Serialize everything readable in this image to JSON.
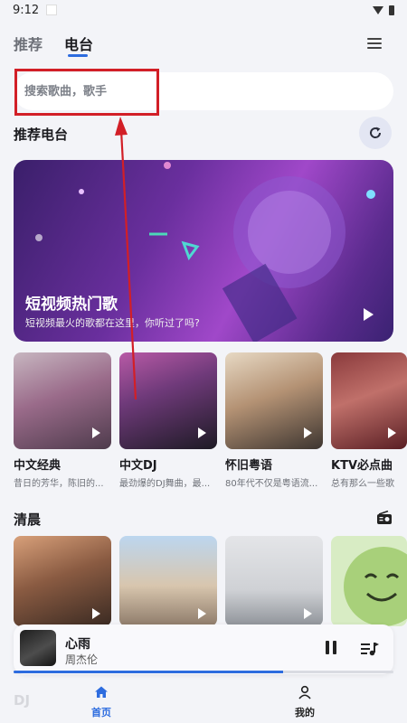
{
  "status": {
    "time": "9:12"
  },
  "topbar": {
    "tabs": [
      {
        "label": "推荐"
      },
      {
        "label": "电台"
      }
    ]
  },
  "search": {
    "placeholder": "搜索歌曲，歌手"
  },
  "sections": {
    "recommended": "推荐电台",
    "morning": "清晨",
    "dj": "DJ"
  },
  "banner": {
    "title": "短视频热门歌",
    "subtitle": "短视频最火的歌都在这里，你听过了吗?"
  },
  "cards": [
    {
      "name": "中文经典",
      "desc": "昔日的芳华，陈旧的..."
    },
    {
      "name": "中文DJ",
      "desc": "最劲爆的DJ舞曲，最..."
    },
    {
      "name": "怀旧粤语",
      "desc": "80年代不仅是粤语流..."
    },
    {
      "name": "KTV必点曲",
      "desc": "总有那么一些歌"
    }
  ],
  "player": {
    "song": "心雨",
    "artist": "周杰伦",
    "progress": 0.71
  },
  "nav": [
    {
      "label": "首页"
    },
    {
      "label": "我的"
    }
  ],
  "colors": {
    "accent": "#2d6cdf",
    "annotation": "#d21f27"
  },
  "icons": [
    "menu-icon",
    "refresh-icon",
    "radio-icon",
    "play-icon",
    "pause-icon",
    "playlist-icon",
    "home-icon",
    "user-icon"
  ]
}
